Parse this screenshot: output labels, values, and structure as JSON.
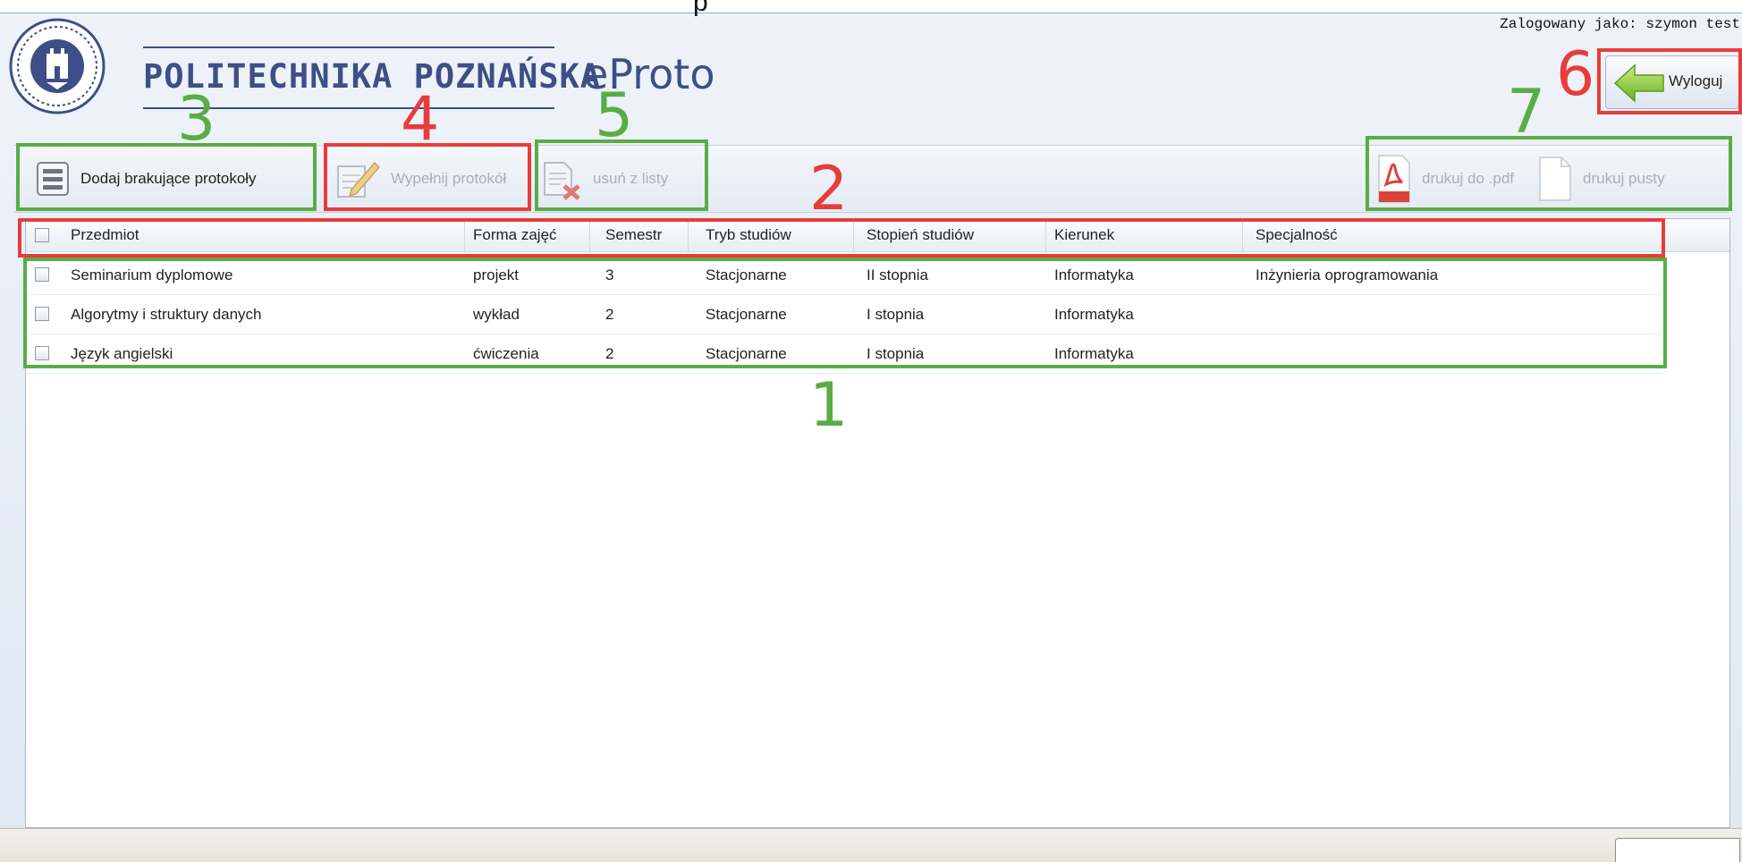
{
  "top_fragment": "p",
  "session": {
    "logged_in_label": "Zalogowany jako: szymon test"
  },
  "brand": {
    "institution": "POLITECHNIKA POZNAŃSKA",
    "app_name": "eProto"
  },
  "logout": {
    "label": "Wyloguj",
    "icon": "arrow-left-icon"
  },
  "toolbar": {
    "add_missing": {
      "label": "Dodaj brakujące protokoły",
      "icon": "list-icon",
      "enabled": true
    },
    "fill_protocol": {
      "label": "Wypełnij protokół",
      "icon": "pencil-document-icon",
      "enabled": false
    },
    "remove_from_list": {
      "label": "usuń z listy",
      "icon": "document-delete-icon",
      "enabled": false
    },
    "print_pdf": {
      "label": "drukuj do .pdf",
      "icon": "pdf-icon",
      "enabled": false
    },
    "print_empty": {
      "label": "drukuj pusty",
      "icon": "blank-page-icon",
      "enabled": false
    }
  },
  "table": {
    "columns": [
      "Przedmiot",
      "Forma zajęć",
      "Semestr",
      "Tryb studiów",
      "Stopień studiów",
      "Kierunek",
      "Specjalność"
    ],
    "rows": [
      [
        "Seminarium dyplomowe",
        "projekt",
        "3",
        "Stacjonarne",
        "II stopnia",
        "Informatyka",
        "Inżynieria oprogramowania"
      ],
      [
        "Algorytmy i struktury danych",
        "wykład",
        "2",
        "Stacjonarne",
        "I stopnia",
        "Informatyka",
        ""
      ],
      [
        "Język angielski",
        "ćwiczenia",
        "2",
        "Stacjonarne",
        "I stopnia",
        "Informatyka",
        ""
      ]
    ]
  },
  "annotations": [
    {
      "number": "1",
      "color": "#5bac45",
      "target": "table rows"
    },
    {
      "number": "2",
      "color": "#e83c3c",
      "target": "table header"
    },
    {
      "number": "3",
      "color": "#5bac45",
      "target": "add missing protocols button"
    },
    {
      "number": "4",
      "color": "#e83c3c",
      "target": "fill protocol button"
    },
    {
      "number": "5",
      "color": "#5bac45",
      "target": "remove from list button"
    },
    {
      "number": "6",
      "color": "#e83c3c",
      "target": "logout button"
    },
    {
      "number": "7",
      "color": "#5bac45",
      "target": "print buttons"
    }
  ],
  "colors": {
    "annotation_green": "#5bac45",
    "annotation_red": "#e83c3c",
    "brand_blue": "#3d4f86"
  }
}
